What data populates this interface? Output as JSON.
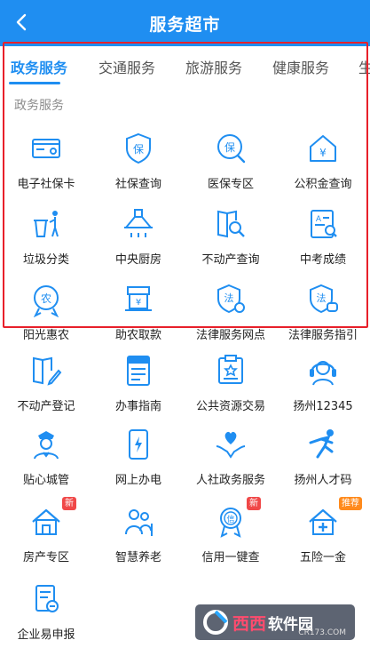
{
  "header": {
    "title": "服务超市"
  },
  "tabs": [
    "政务服务",
    "交通服务",
    "旅游服务",
    "健康服务",
    "生"
  ],
  "section_title": "政务服务",
  "grid": [
    {
      "label": "电子社保卡",
      "icon": "social-security-card-icon"
    },
    {
      "label": "社保查询",
      "icon": "shield-bao-icon"
    },
    {
      "label": "医保专区",
      "icon": "medical-insurance-icon"
    },
    {
      "label": "公积金查询",
      "icon": "housing-fund-icon"
    },
    {
      "label": "垃圾分类",
      "icon": "trash-sorting-icon"
    },
    {
      "label": "中央厨房",
      "icon": "kitchen-hood-icon"
    },
    {
      "label": "不动产查询",
      "icon": "book-search-icon"
    },
    {
      "label": "中考成绩",
      "icon": "exam-score-icon"
    },
    {
      "label": "阳光惠农",
      "icon": "nong-badge-icon"
    },
    {
      "label": "助农取款",
      "icon": "bank-withdraw-icon"
    },
    {
      "label": "法律服务网点",
      "icon": "law-location-icon"
    },
    {
      "label": "法律服务指引",
      "icon": "law-guide-icon"
    },
    {
      "label": "不动产登记",
      "icon": "book-register-icon"
    },
    {
      "label": "办事指南",
      "icon": "guide-book-icon"
    },
    {
      "label": "公共资源交易",
      "icon": "public-resource-icon"
    },
    {
      "label": "扬州12345",
      "icon": "headset-icon"
    },
    {
      "label": "贴心城管",
      "icon": "officer-icon"
    },
    {
      "label": "网上办电",
      "icon": "phone-power-icon"
    },
    {
      "label": "人社政务服务",
      "icon": "heart-hands-icon"
    },
    {
      "label": "扬州人才码",
      "icon": "runner-icon"
    },
    {
      "label": "房产专区",
      "icon": "house-icon",
      "badge": "新"
    },
    {
      "label": "智慧养老",
      "icon": "elderly-icon"
    },
    {
      "label": "信用一键查",
      "icon": "credit-medal-icon",
      "badge": "新"
    },
    {
      "label": "五险一金",
      "icon": "insurance-house-icon",
      "badge": "推荐"
    },
    {
      "label": "企业易申报",
      "icon": "enterprise-report-icon"
    }
  ],
  "colors": {
    "primary": "#1f8ef1",
    "highlight": "#e8202a",
    "badge_new": "#f04848",
    "badge_recommend": "#ff8a1c"
  },
  "watermark": {
    "brand": "西西",
    "brand2": "软件园",
    "url": "CR173.COM"
  }
}
